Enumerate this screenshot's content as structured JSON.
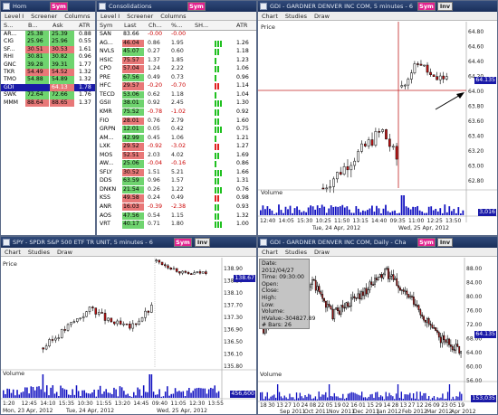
{
  "colors": {
    "sym": "#e3228f",
    "title": "#1a2f5a",
    "green": "#6fd46f",
    "red": "#e87878",
    "blue": "#1a1aa8"
  },
  "win1": {
    "title": "Hom",
    "sym": "Sym",
    "menu": [
      "Level I",
      "Screener",
      "Columns"
    ],
    "cols": [
      "S...",
      "B...",
      "Ask",
      "ATR"
    ],
    "rows": [
      {
        "s": "AR...",
        "b": "25.38",
        "a": "25.39",
        "atr": "0.88",
        "c": "g"
      },
      {
        "s": "CIG",
        "b": "25.96",
        "a": "25.96",
        "atr": "0.55",
        "c": "g"
      },
      {
        "s": "SF...",
        "b": "30.51",
        "a": "30.53",
        "atr": "1.61",
        "c": "r"
      },
      {
        "s": "RHI",
        "b": "30.81",
        "a": "30.82",
        "atr": "0.96",
        "c": "g"
      },
      {
        "s": "GNC",
        "b": "39.28",
        "a": "39.31",
        "atr": "1.77",
        "c": "g"
      },
      {
        "s": "TKR",
        "b": "54.49",
        "a": "54.52",
        "atr": "1.32",
        "c": "r"
      },
      {
        "s": "TMO",
        "b": "54.88",
        "a": "54.89",
        "atr": "1.32",
        "c": "g"
      },
      {
        "s": "GDI",
        "b": "",
        "a": "64.13",
        "atr": "1.78",
        "c": "sel"
      },
      {
        "s": "SWK",
        "b": "72.64",
        "a": "72.66",
        "atr": "1.76",
        "c": "g"
      },
      {
        "s": "MMM",
        "b": "88.64",
        "a": "88.65",
        "atr": "1.37",
        "c": "r"
      }
    ]
  },
  "win2": {
    "title": "Consolidations",
    "sym": "Sym",
    "menu": [
      "Level I",
      "Screener",
      "Columns"
    ],
    "cols": [
      "Sym",
      "Last",
      "Ch...",
      "%...",
      "SH...",
      "ATR"
    ],
    "rows": [
      {
        "s": "SAN",
        "l": "83.66",
        "ch": "-0.00",
        "p": "-0.00",
        "atr": "",
        "c": ""
      },
      {
        "s": "AG...",
        "l": "46.04",
        "ch": "0.86",
        "p": "1.95",
        "atr": "1.26",
        "c": "r"
      },
      {
        "s": "NVLS",
        "l": "45.07",
        "ch": "0.27",
        "p": "0.60",
        "atr": "1.18",
        "c": "g"
      },
      {
        "s": "HSIC",
        "l": "75.57",
        "ch": "1.37",
        "p": "1.85",
        "atr": "1.23",
        "c": "r"
      },
      {
        "s": "CPO",
        "l": "57.04",
        "ch": "1.24",
        "p": "2.22",
        "atr": "1.06",
        "c": "r"
      },
      {
        "s": "PRE",
        "l": "67.56",
        "ch": "0.49",
        "p": "0.73",
        "atr": "0.96",
        "c": "g"
      },
      {
        "s": "HFC",
        "l": "29.57",
        "ch": "-0.20",
        "p": "-0.70",
        "atr": "1.14",
        "c": "r"
      },
      {
        "s": "TECD",
        "l": "53.06",
        "ch": "0.62",
        "p": "1.18",
        "atr": "1.04",
        "c": "g"
      },
      {
        "s": "GSII",
        "l": "38.01",
        "ch": "0.92",
        "p": "2.45",
        "atr": "1.30",
        "c": "g"
      },
      {
        "s": "KMR",
        "l": "75.52",
        "ch": "-0.78",
        "p": "-1.02",
        "atr": "0.92",
        "c": "g"
      },
      {
        "s": "FIO",
        "l": "28.01",
        "ch": "0.76",
        "p": "2.79",
        "atr": "1.60",
        "c": "r"
      },
      {
        "s": "GRPN",
        "l": "12.01",
        "ch": "0.05",
        "p": "0.42",
        "atr": "0.75",
        "c": "g"
      },
      {
        "s": "AM...",
        "l": "42.99",
        "ch": "0.45",
        "p": "1.06",
        "atr": "1.21",
        "c": "g"
      },
      {
        "s": "LXK",
        "l": "29.52",
        "ch": "-0.92",
        "p": "-3.02",
        "atr": "1.27",
        "c": "r"
      },
      {
        "s": "MOS",
        "l": "52.51",
        "ch": "2.03",
        "p": "4.02",
        "atr": "1.69",
        "c": "r"
      },
      {
        "s": "AW...",
        "l": "25.06",
        "ch": "-0.04",
        "p": "-0.16",
        "atr": "0.86",
        "c": "g"
      },
      {
        "s": "SFLY",
        "l": "30.52",
        "ch": "1.51",
        "p": "5.21",
        "atr": "1.66",
        "c": "r"
      },
      {
        "s": "DDS",
        "l": "63.59",
        "ch": "0.96",
        "p": "1.57",
        "atr": "1.31",
        "c": "g"
      },
      {
        "s": "DNKN",
        "l": "21.54",
        "ch": "0.26",
        "p": "1.22",
        "atr": "0.76",
        "c": "g"
      },
      {
        "s": "KSS",
        "l": "49.58",
        "ch": "0.24",
        "p": "0.49",
        "atr": "0.98",
        "c": "r"
      },
      {
        "s": "ANR",
        "l": "16.03",
        "ch": "-0.39",
        "p": "-2.38",
        "atr": "0.93",
        "c": "r"
      },
      {
        "s": "AOS",
        "l": "47.56",
        "ch": "0.54",
        "p": "1.15",
        "atr": "1.32",
        "c": "g"
      },
      {
        "s": "VRT",
        "l": "40.17",
        "ch": "0.71",
        "p": "1.80",
        "atr": "1.00",
        "c": "g"
      }
    ]
  },
  "win3": {
    "title": "GDI - GARDNER DENVER INC COM, 5 minutes - 6",
    "sym": "Sym",
    "inv": "Inv",
    "menu": [
      "Chart",
      "Studies",
      "Draw"
    ],
    "price_label": "Price",
    "vol_label": "Volume",
    "current": "64.135",
    "vol_cur": "3,016",
    "yticks": [
      "64.80",
      "64.60",
      "64.40",
      "64.20",
      "64.00",
      "63.80",
      "63.60",
      "63.40",
      "63.20",
      "63.00",
      "62.80"
    ],
    "xticks": [
      "12:40",
      "14:05",
      "15:30",
      "10:25",
      "11:50",
      "13:15",
      "14:40",
      "09:35",
      "11:00",
      "12:25",
      "13:50"
    ],
    "dates": [
      "Tue, 24 Apr, 2012",
      "Wed, 25 Apr, 2012"
    ]
  },
  "win4": {
    "title": "SPY - SPDR S&P 500 ETF TR UNIT, 5 minutes - 6",
    "sym": "Sym",
    "inv": "Inv",
    "menu": [
      "Chart",
      "Studies",
      "Draw"
    ],
    "price_label": "Price",
    "vol_label": "Volume",
    "current": "138.67",
    "vol_cur": "456,600",
    "yticks": [
      "138.90",
      "138.50",
      "138.10",
      "137.70",
      "137.30",
      "136.90",
      "136.50",
      "136.10",
      "135.80"
    ],
    "xticks": [
      "1:20",
      "12:45",
      "14:10",
      "15:35",
      "10:30",
      "11:55",
      "13:20",
      "14:45",
      "09:40",
      "11:05",
      "12:30",
      "13:55"
    ],
    "dates": [
      "Mon, 23 Apr, 2012",
      "Tue, 24 Apr, 2012",
      "Wed, 25 Apr, 2012"
    ]
  },
  "win5": {
    "title": "GDI - GARDNER DENVER INC COM, Daily - Cha",
    "sym": "Sym",
    "inv": "Inv",
    "menu": [
      "Chart",
      "Studies",
      "Draw"
    ],
    "price_label": "Price",
    "vol_label": "Volume",
    "current": "64.135",
    "vol_cur": "153,035",
    "info": {
      "date_l": "Date:",
      "date_v": "2012/04/27",
      "time_l": "Time:",
      "time_v": "09:30:00",
      "open_l": "Open:",
      "close_l": "Close:",
      "high_l": "High:",
      "low_l": "Low:",
      "vol_l": "Volume:",
      "hv_l": "HValue:",
      "hv_v": "-304827.89",
      "bars_l": "# Bars:",
      "bars_v": "26"
    },
    "yticks": [
      "88.00",
      "84.00",
      "80.00",
      "76.00",
      "72.00",
      "68.00",
      "64.00",
      "60.00",
      "56.00"
    ],
    "xticks": [
      "18",
      "30",
      "13",
      "27",
      "10",
      "24",
      "08",
      "22",
      "05",
      "19",
      "02",
      "16",
      "01",
      "15",
      "29",
      "14",
      "28",
      "13",
      "27",
      "12",
      "26",
      "09",
      "23",
      "05",
      "19"
    ],
    "months": [
      "Sep 2011",
      "Oct 2011",
      "Nov 2011",
      "Dec 2011",
      "Jan 2012",
      "Feb 2012",
      "Mar 2012",
      "Apr 2012"
    ]
  }
}
